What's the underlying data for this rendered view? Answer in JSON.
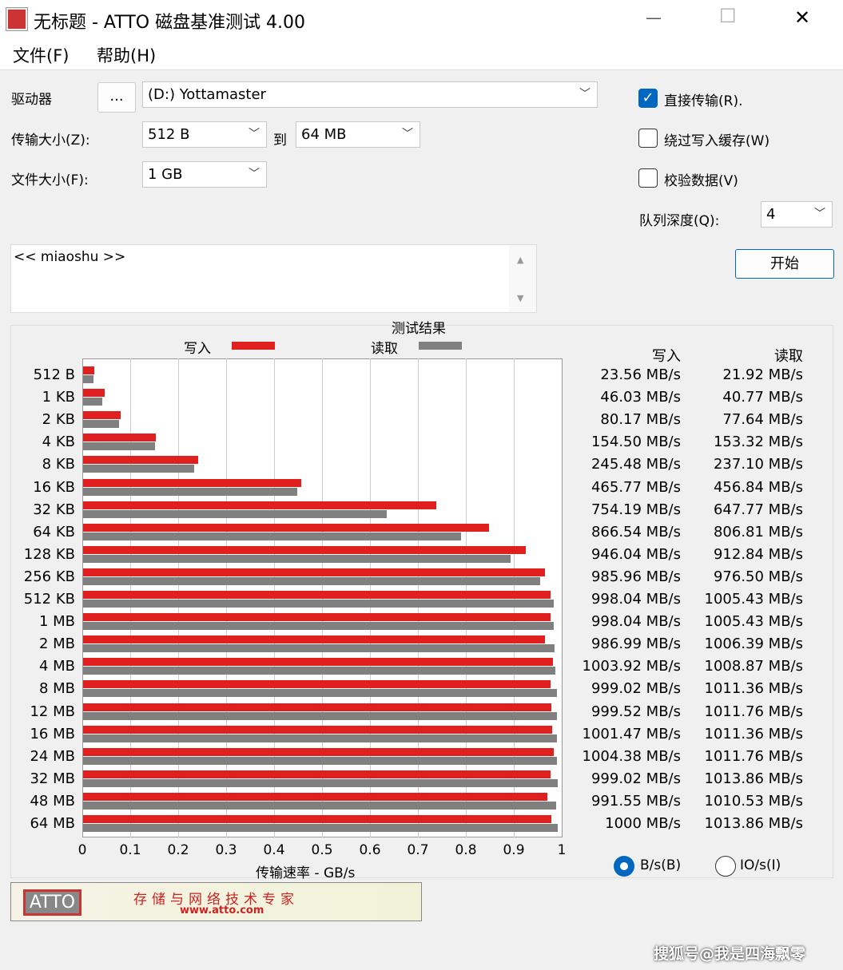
{
  "window": {
    "title": "无标题 - ATTO 磁盘基准测试 4.00",
    "minimize": "—",
    "maximize": "☐",
    "close": "✕"
  },
  "menu": [
    "文件(F)",
    "帮助(H)"
  ],
  "form": {
    "drive_label": "驱动器",
    "browse_button": "...",
    "drive_value": "(D:) Yottamaster",
    "transfer_label": "传输大小(Z):",
    "transfer_from": "512 B",
    "to_label": "到",
    "transfer_to": "64 MB",
    "file_label": "文件大小(F):",
    "file_value": "1 GB",
    "direct_io": "直接传输(R).",
    "direct_io_checked": true,
    "bypass_cache": "绕过写入缓存(W)",
    "bypass_cache_checked": false,
    "verify": "校验数据(V)",
    "verify_checked": false,
    "queue_label": "队列深度(Q):",
    "queue_value": "4",
    "start_button": "开始",
    "description": "<< miaoshu >>"
  },
  "results": {
    "title": "测试结果",
    "write_header": "写入",
    "read_header": "读取",
    "unit_bs": "B/s(B)",
    "unit_ios": "IO/s(I)",
    "unit_selected": "B/s"
  },
  "chart_data": {
    "type": "bar",
    "orientation": "horizontal",
    "xlabel": "传输速率 - GB/s",
    "xlim": [
      0,
      1
    ],
    "xticks": [
      "0",
      "0.1",
      "0.2",
      "0.3",
      "0.4",
      "0.5",
      "0.6",
      "0.7",
      "0.8",
      "0.9",
      "1"
    ],
    "legend": [
      {
        "name": "写入",
        "color": "#e0201e"
      },
      {
        "name": "读取",
        "color": "#808080"
      }
    ],
    "categories": [
      "512 B",
      "1 KB",
      "2 KB",
      "4 KB",
      "8 KB",
      "16 KB",
      "32 KB",
      "64 KB",
      "128 KB",
      "256 KB",
      "512 KB",
      "1 MB",
      "2 MB",
      "4 MB",
      "8 MB",
      "12 MB",
      "16 MB",
      "24 MB",
      "32 MB",
      "48 MB",
      "64 MB"
    ],
    "series": [
      {
        "name": "写入",
        "unit": "MB/s",
        "values": [
          23.56,
          46.03,
          80.17,
          154.5,
          245.48,
          465.77,
          754.19,
          866.54,
          946.04,
          985.96,
          998.04,
          998.04,
          986.99,
          1003.92,
          999.02,
          999.52,
          1001.47,
          1004.38,
          999.02,
          991.55,
          1000
        ]
      },
      {
        "name": "读取",
        "unit": "MB/s",
        "values": [
          21.92,
          40.77,
          77.64,
          153.32,
          237.1,
          456.84,
          647.77,
          806.81,
          912.84,
          976.5,
          1005.43,
          1005.43,
          1006.39,
          1008.87,
          1011.36,
          1011.76,
          1011.36,
          1011.76,
          1013.86,
          1010.53,
          1013.86
        ]
      }
    ]
  },
  "banner": {
    "logo": "ATTO",
    "slogan": "存储与网络技术专家",
    "url": "www.atto.com"
  },
  "watermark": "搜狐号@我是四海飘零"
}
